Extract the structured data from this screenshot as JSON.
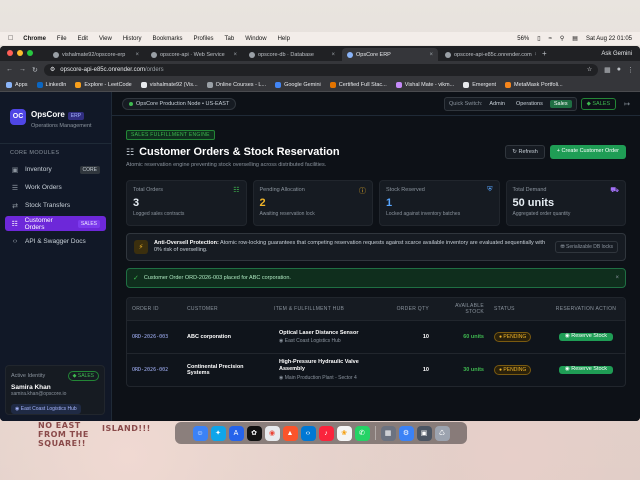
{
  "wallpaper": {
    "doodle_left": "NO EAST FROM THE SQUARE!!",
    "doodle_right": "ISLAND!!!"
  },
  "menubar": {
    "app": "Chrome",
    "items": [
      "File",
      "Edit",
      "View",
      "History",
      "Bookmarks",
      "Profiles",
      "Tab",
      "Window",
      "Help"
    ],
    "battery": "56%",
    "datetime": "Sat Aug 22  01:05"
  },
  "browser": {
    "tabs": [
      {
        "label": "vishalmate92/opscore-erp"
      },
      {
        "label": "opscore-api · Web Service"
      },
      {
        "label": "opscore-db · Database"
      },
      {
        "label": "OpsCore ERP"
      },
      {
        "label": "opscore-api-e85c.onrender.com"
      }
    ],
    "ask_gemini": "Ask Gemini",
    "url_host": "opscore-api-e85c.onrender.com",
    "url_path": "/orders",
    "bookmarks": [
      "Apps",
      "LinkedIn",
      "Explore - LeetCode",
      "vishalmate92 (Vis...",
      "Online Courses - L...",
      "Google Gemini",
      "Certified Full Stac...",
      "Vishal Mate - vikm...",
      "Emergent",
      "MetaMask Portfoli..."
    ]
  },
  "sidebar": {
    "brand": "OpsCore",
    "brand_badge": "ERP",
    "brand_sub": "Operations Management",
    "section": "CORE MODULES",
    "items": [
      {
        "label": "Inventory",
        "tag": "CORE"
      },
      {
        "label": "Work Orders",
        "tag": ""
      },
      {
        "label": "Stock Transfers",
        "tag": ""
      },
      {
        "label": "Customer Orders",
        "tag": "SALES"
      },
      {
        "label": "API & Swagger Docs",
        "tag": ""
      }
    ],
    "identity": {
      "label": "Active Identity",
      "role": "SALES",
      "name": "Samira Khan",
      "email": "samira.khan@opscore.io",
      "hub": "East Coast Logistics Hub"
    }
  },
  "topbar": {
    "node": "OpsCore Production Node • US-EAST",
    "quick_switch": "Quick Switch:",
    "roles": [
      "Admin",
      "Operations",
      "Sales"
    ],
    "selected_role": "Sales",
    "role_badge": "SALES"
  },
  "page": {
    "badge": "SALES FULFILLMENT ENGINE",
    "title": "Customer Orders & Stock Reservation",
    "subtitle": "Atomic reservation engine preventing stock overselling across distributed facilities.",
    "refresh": "Refresh",
    "create": "+ Create Customer Order"
  },
  "stats": [
    {
      "label": "Total Orders",
      "value": "3",
      "desc": "Logged sales contracts",
      "color": "#e6edf3",
      "icon_color": "#3fb950"
    },
    {
      "label": "Pending Allocation",
      "value": "2",
      "desc": "Awaiting reservation lock",
      "color": "#f0b429",
      "icon_color": "#f0b429"
    },
    {
      "label": "Stock Reserved",
      "value": "1",
      "desc": "Locked against inventory batches",
      "color": "#58a6ff",
      "icon_color": "#58a6ff"
    },
    {
      "label": "Total Demand",
      "value": "50 units",
      "desc": "Aggregated order quantity",
      "color": "#e6edf3",
      "icon_color": "#a371f7"
    }
  ],
  "notice": {
    "title": "Anti-Oversell Protection:",
    "text": " Atomic row-locking guarantees that competing reservation requests against scarce available inventory are evaluated sequentially with 0% risk of overselling.",
    "tag": "Serializable DB locks"
  },
  "success": {
    "text": "Customer Order ORD-2026-003 placed for ABC corporation."
  },
  "table": {
    "headers": [
      "ORDER ID",
      "CUSTOMER",
      "ITEM & FULFILLMENT HUB",
      "ORDER QTY",
      "AVAILABLE STOCK",
      "STATUS",
      "RESERVATION ACTION"
    ],
    "rows": [
      {
        "id": "ORD-2026-003",
        "customer": "ABC corporation",
        "item": "Optical Laser Distance Sensor",
        "hub": "East Coast Logistics Hub",
        "qty": "10",
        "available": "60 units",
        "status": "PENDING",
        "action": "Reserve Stock"
      },
      {
        "id": "ORD-2026-002",
        "customer": "Continental Precision Systems",
        "item": "High-Pressure Hydraulic Valve Assembly",
        "hub": "Main Production Plant - Sector 4",
        "qty": "10",
        "available": "30 units",
        "status": "PENDING",
        "action": "Reserve Stock"
      }
    ]
  },
  "dock": [
    "finder-icon",
    "safari-icon",
    "app-store-icon",
    "chatgpt-icon",
    "chrome-icon",
    "brave-icon",
    "vscode-icon",
    "music-icon",
    "photos-icon",
    "whatsapp-icon",
    "calculator-icon",
    "settings-icon",
    "downloads-icon",
    "trash-icon"
  ]
}
